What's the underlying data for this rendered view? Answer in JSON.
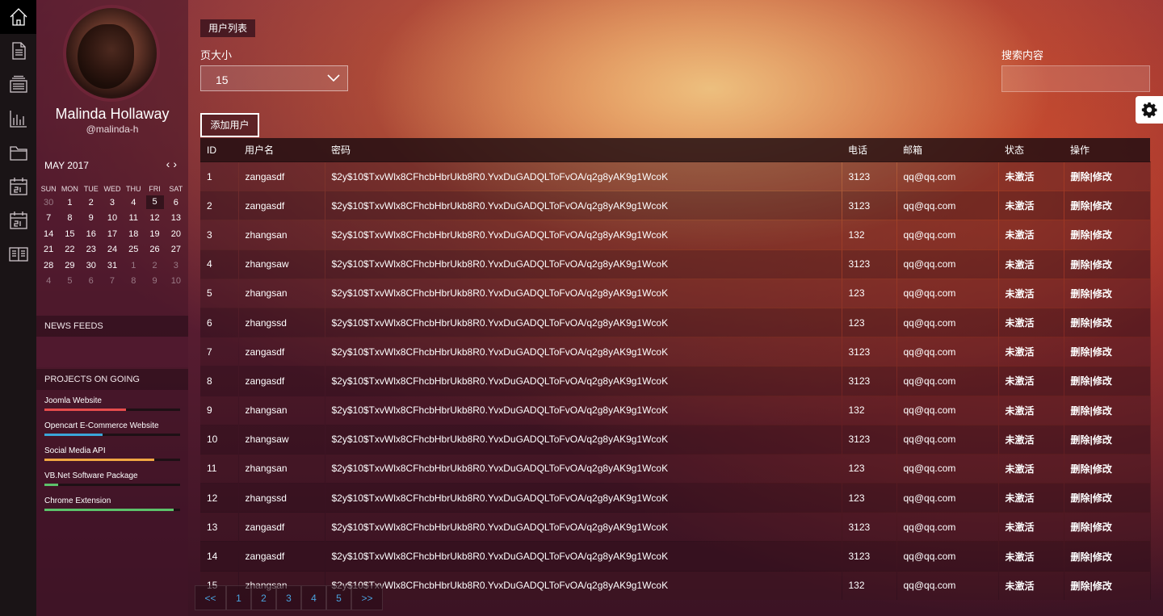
{
  "rail": [
    {
      "icon": "home-icon",
      "active": true
    },
    {
      "icon": "document-icon"
    },
    {
      "icon": "stack-icon"
    },
    {
      "icon": "bar-chart-icon"
    },
    {
      "icon": "folder-icon"
    },
    {
      "icon": "calendar-icon"
    },
    {
      "icon": "calendar-icon"
    },
    {
      "icon": "book-icon"
    }
  ],
  "profile": {
    "name": "Malinda Hollaway",
    "handle": "@malinda-h"
  },
  "calendar": {
    "month": "MAY 2017",
    "weekdays": [
      "SUN",
      "MON",
      "TUE",
      "WED",
      "THU",
      "FRI",
      "SAT"
    ],
    "weeks": [
      [
        [
          "30",
          true
        ],
        [
          "1"
        ],
        [
          "2"
        ],
        [
          "3"
        ],
        [
          "4"
        ],
        [
          "5",
          false,
          true
        ],
        [
          "6"
        ]
      ],
      [
        [
          "7"
        ],
        [
          "8"
        ],
        [
          "9"
        ],
        [
          "10"
        ],
        [
          "11"
        ],
        [
          "12"
        ],
        [
          "13"
        ]
      ],
      [
        [
          "14"
        ],
        [
          "15"
        ],
        [
          "16"
        ],
        [
          "17"
        ],
        [
          "18"
        ],
        [
          "19"
        ],
        [
          "20"
        ]
      ],
      [
        [
          "21"
        ],
        [
          "22"
        ],
        [
          "23"
        ],
        [
          "24"
        ],
        [
          "25"
        ],
        [
          "26"
        ],
        [
          "27"
        ]
      ],
      [
        [
          "28"
        ],
        [
          "29"
        ],
        [
          "30"
        ],
        [
          "31"
        ],
        [
          "1",
          true
        ],
        [
          "2",
          true
        ],
        [
          "3",
          true
        ]
      ],
      [
        [
          "4",
          true
        ],
        [
          "5",
          true
        ],
        [
          "6",
          true
        ],
        [
          "7",
          true
        ],
        [
          "8",
          true
        ],
        [
          "9",
          true
        ],
        [
          "10",
          true
        ]
      ]
    ]
  },
  "news_feeds": {
    "title": "NEWS FEEDS"
  },
  "projects": {
    "title": "PROJECTS ON GOING",
    "items": [
      {
        "name": "Joomla Website",
        "progress": 0.6,
        "color": "#e64c4c"
      },
      {
        "name": "Opencart E-Commerce Website",
        "progress": 0.43,
        "color": "#3aa6d8"
      },
      {
        "name": "Social Media API",
        "progress": 0.81,
        "color": "#f0a742"
      },
      {
        "name": "VB.Net Software Package",
        "progress": 0.1,
        "color": "#5cc26a"
      },
      {
        "name": "Chrome Extension",
        "progress": 0.95,
        "color": "#5cc26a"
      }
    ]
  },
  "main": {
    "tag": "用户列表",
    "page_size_label": "页大小",
    "page_size_value": "15",
    "search_label": "搜索内容",
    "search_value": "",
    "add_button": "添加用户"
  },
  "table": {
    "columns": [
      "ID",
      "用户名",
      "密码",
      "电话",
      "邮箱",
      "状态",
      "操作"
    ],
    "delete_label": "删除",
    "sep": "|",
    "edit_label": "修改",
    "rows": [
      [
        "1",
        "zangasdf",
        "$2y$10$TxvWlx8CFhcbHbrUkb8R0.YvxDuGADQLToFvOA/q2g8yAK9g1WcoK",
        "3123",
        "qq@qq.com",
        "未激活"
      ],
      [
        "2",
        "zangasdf",
        "$2y$10$TxvWlx8CFhcbHbrUkb8R0.YvxDuGADQLToFvOA/q2g8yAK9g1WcoK",
        "3123",
        "qq@qq.com",
        "未激活"
      ],
      [
        "3",
        "zhangsan",
        "$2y$10$TxvWlx8CFhcbHbrUkb8R0.YvxDuGADQLToFvOA/q2g8yAK9g1WcoK",
        "132",
        "qq@qq.com",
        "未激活"
      ],
      [
        "4",
        "zhangsaw",
        "$2y$10$TxvWlx8CFhcbHbrUkb8R0.YvxDuGADQLToFvOA/q2g8yAK9g1WcoK",
        "3123",
        "qq@qq.com",
        "未激活"
      ],
      [
        "5",
        "zhangsan",
        "$2y$10$TxvWlx8CFhcbHbrUkb8R0.YvxDuGADQLToFvOA/q2g8yAK9g1WcoK",
        "123",
        "qq@qq.com",
        "未激活"
      ],
      [
        "6",
        "zhangssd",
        "$2y$10$TxvWlx8CFhcbHbrUkb8R0.YvxDuGADQLToFvOA/q2g8yAK9g1WcoK",
        "123",
        "qq@qq.com",
        "未激活"
      ],
      [
        "7",
        "zangasdf",
        "$2y$10$TxvWlx8CFhcbHbrUkb8R0.YvxDuGADQLToFvOA/q2g8yAK9g1WcoK",
        "3123",
        "qq@qq.com",
        "未激活"
      ],
      [
        "8",
        "zangasdf",
        "$2y$10$TxvWlx8CFhcbHbrUkb8R0.YvxDuGADQLToFvOA/q2g8yAK9g1WcoK",
        "3123",
        "qq@qq.com",
        "未激活"
      ],
      [
        "9",
        "zhangsan",
        "$2y$10$TxvWlx8CFhcbHbrUkb8R0.YvxDuGADQLToFvOA/q2g8yAK9g1WcoK",
        "132",
        "qq@qq.com",
        "未激活"
      ],
      [
        "10",
        "zhangsaw",
        "$2y$10$TxvWlx8CFhcbHbrUkb8R0.YvxDuGADQLToFvOA/q2g8yAK9g1WcoK",
        "3123",
        "qq@qq.com",
        "未激活"
      ],
      [
        "11",
        "zhangsan",
        "$2y$10$TxvWlx8CFhcbHbrUkb8R0.YvxDuGADQLToFvOA/q2g8yAK9g1WcoK",
        "123",
        "qq@qq.com",
        "未激活"
      ],
      [
        "12",
        "zhangssd",
        "$2y$10$TxvWlx8CFhcbHbrUkb8R0.YvxDuGADQLToFvOA/q2g8yAK9g1WcoK",
        "123",
        "qq@qq.com",
        "未激活"
      ],
      [
        "13",
        "zangasdf",
        "$2y$10$TxvWlx8CFhcbHbrUkb8R0.YvxDuGADQLToFvOA/q2g8yAK9g1WcoK",
        "3123",
        "qq@qq.com",
        "未激活"
      ],
      [
        "14",
        "zangasdf",
        "$2y$10$TxvWlx8CFhcbHbrUkb8R0.YvxDuGADQLToFvOA/q2g8yAK9g1WcoK",
        "3123",
        "qq@qq.com",
        "未激活"
      ],
      [
        "15",
        "zhangsan",
        "$2y$10$TxvWlx8CFhcbHbrUkb8R0.YvxDuGADQLToFvOA/q2g8yAK9g1WcoK",
        "132",
        "qq@qq.com",
        "未激活"
      ]
    ]
  },
  "pagination": {
    "prev": "<<",
    "pages": [
      "1",
      "2",
      "3",
      "4",
      "5"
    ],
    "next": ">>"
  }
}
